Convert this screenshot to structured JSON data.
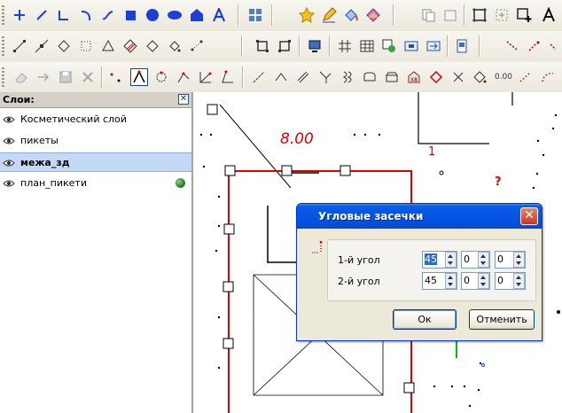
{
  "layers_panel": {
    "title": "Слои:",
    "close": "✕",
    "layers": [
      {
        "name": "Косметический слой",
        "bold": false,
        "selected": false
      },
      {
        "name": "пикеты",
        "bold": false,
        "selected": false
      },
      {
        "name": "межа_зд",
        "bold": true,
        "selected": true
      },
      {
        "name": "план_пикети",
        "bold": false,
        "selected": false
      }
    ]
  },
  "drawing": {
    "dimension_label": "8.00",
    "point_label": "1",
    "unknown_marker": "?",
    "zero_label": "0.00"
  },
  "dialog": {
    "title": "Угловые засечки",
    "close": "✕",
    "row1": {
      "label": "1-й угол",
      "deg": "45",
      "min": "0",
      "sec": "0"
    },
    "row2": {
      "label": "2-й угол",
      "deg": "45",
      "min": "0",
      "sec": "0"
    },
    "ok": "Ок",
    "cancel": "Отменить"
  },
  "colors": {
    "accent_blue": "#1c3fd6",
    "drawing_red": "#e00000",
    "selection": "#c3d9f5"
  }
}
